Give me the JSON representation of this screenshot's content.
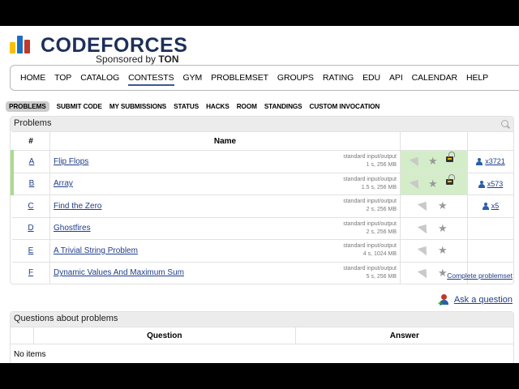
{
  "logo": {
    "word": "CODEFORCES",
    "sponsor_prefix": "Sponsored by",
    "sponsor_name": "TON",
    "bar_colors": [
      "#f8c200",
      "#1a6fc2",
      "#c0392b"
    ]
  },
  "menu": {
    "items": [
      "HOME",
      "TOP",
      "CATALOG",
      "CONTESTS",
      "GYM",
      "PROBLEMSET",
      "GROUPS",
      "RATING",
      "EDU",
      "API",
      "CALENDAR",
      "HELP"
    ],
    "active": "CONTESTS"
  },
  "tabs": {
    "items": [
      "PROBLEMS",
      "SUBMIT CODE",
      "MY SUBMISSIONS",
      "STATUS",
      "HACKS",
      "ROOM",
      "STANDINGS",
      "CUSTOM INVOCATION"
    ],
    "selected": "PROBLEMS"
  },
  "problems_panel": {
    "title": "Problems",
    "headers": {
      "index": "#",
      "name": "Name"
    },
    "rows": [
      {
        "index": "A",
        "name": "Flip Flops",
        "io": "standard input/output",
        "limits": "1 s, 256 MB",
        "solved": "x3721",
        "accepted": true
      },
      {
        "index": "B",
        "name": "Array",
        "io": "standard input/output",
        "limits": "1.5 s, 256 MB",
        "solved": "x573",
        "accepted": true
      },
      {
        "index": "C",
        "name": "Find the Zero",
        "io": "standard input/output",
        "limits": "2 s, 256 MB",
        "solved": "x5",
        "accepted": false
      },
      {
        "index": "D",
        "name": "Ghostfires",
        "io": "standard input/output",
        "limits": "2 s, 256 MB",
        "solved": "",
        "accepted": false
      },
      {
        "index": "E",
        "name": "A Trivial String Problem",
        "io": "standard input/output",
        "limits": "4 s, 1024 MB",
        "solved": "",
        "accepted": false
      },
      {
        "index": "F",
        "name": "Dynamic Values And Maximum Sum",
        "io": "standard input/output",
        "limits": "5 s, 256 MB",
        "solved": "",
        "accepted": false
      }
    ]
  },
  "links": {
    "complete_problemset": "Complete problemset",
    "ask_question": "Ask a question"
  },
  "questions_panel": {
    "title": "Questions about problems",
    "headers": {
      "question": "Question",
      "answer": "Answer"
    },
    "empty_text": "No items"
  }
}
